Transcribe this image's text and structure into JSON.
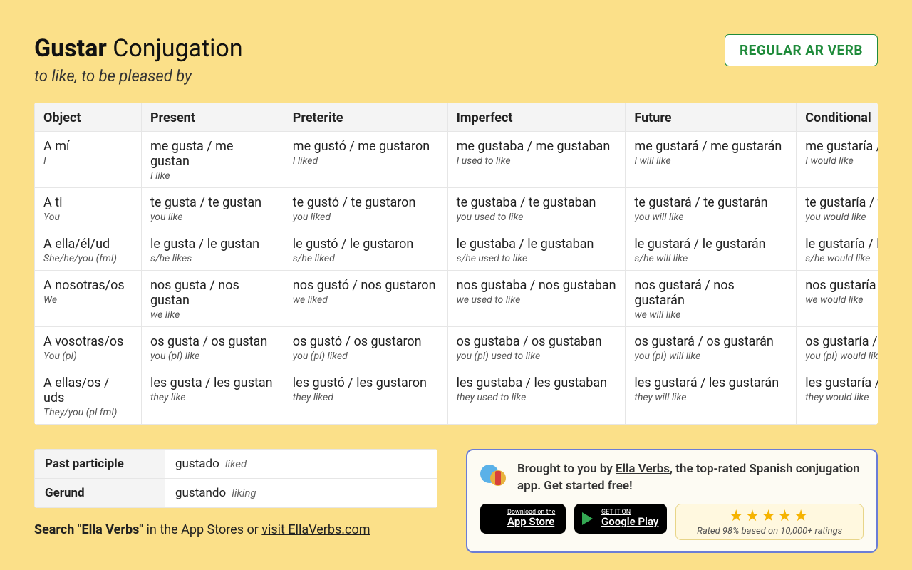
{
  "header": {
    "verb": "Gustar",
    "title_rest": " Conjugation",
    "subtitle": "to like, to be pleased by",
    "badge": "REGULAR AR VERB"
  },
  "columns": [
    "Object",
    "Present",
    "Preterite",
    "Imperfect",
    "Future",
    "Conditional"
  ],
  "rows": [
    {
      "obj_es": "A mí",
      "obj_en": "I",
      "cells": [
        {
          "es": "me gusta / me gustan",
          "en": "I like"
        },
        {
          "es": "me gustó / me gustaron",
          "en": "I liked"
        },
        {
          "es": "me gustaba / me gustaban",
          "en": "I used to like"
        },
        {
          "es": "me gustará / me gustarán",
          "en": "I will like"
        },
        {
          "es": "me gustaría / me gustarían",
          "en": "I would like"
        }
      ]
    },
    {
      "obj_es": "A ti",
      "obj_en": "You",
      "cells": [
        {
          "es": "te gusta / te gustan",
          "en": "you like"
        },
        {
          "es": "te gustó / te gustaron",
          "en": "you liked"
        },
        {
          "es": "te gustaba / te gustaban",
          "en": "you used to like"
        },
        {
          "es": "te gustará / te gustarán",
          "en": "you will like"
        },
        {
          "es": "te gustaría / te gustarían",
          "en": "you would like"
        }
      ]
    },
    {
      "obj_es": "A ella/él/ud",
      "obj_en": "She/he/you (fml)",
      "cells": [
        {
          "es": "le gusta / le gustan",
          "en": "s/he likes"
        },
        {
          "es": "le gustó / le gustaron",
          "en": "s/he liked"
        },
        {
          "es": "le gustaba / le gustaban",
          "en": "s/he used to like"
        },
        {
          "es": "le gustará / le gustarán",
          "en": "s/he will like"
        },
        {
          "es": "le gustaría / le gustarían",
          "en": "s/he would like"
        }
      ]
    },
    {
      "obj_es": "A nosotras/os",
      "obj_en": "We",
      "cells": [
        {
          "es": "nos gusta / nos gustan",
          "en": "we like"
        },
        {
          "es": "nos gustó / nos gustaron",
          "en": "we liked"
        },
        {
          "es": "nos gustaba / nos gustaban",
          "en": "we used to like"
        },
        {
          "es": "nos gustará / nos gustarán",
          "en": "we will like"
        },
        {
          "es": "nos gustaría / nos gustarían",
          "en": "we would like"
        }
      ]
    },
    {
      "obj_es": "A vosotras/os",
      "obj_en": "You (pl)",
      "cells": [
        {
          "es": "os gusta / os gustan",
          "en": "you (pl) like"
        },
        {
          "es": "os gustó / os gustaron",
          "en": "you (pl) liked"
        },
        {
          "es": "os gustaba / os gustaban",
          "en": "you (pl) used to like"
        },
        {
          "es": "os gustará / os gustarán",
          "en": "you (pl) will like"
        },
        {
          "es": "os gustaría / os gustarían",
          "en": "you (pl) would like"
        }
      ]
    },
    {
      "obj_es": "A ellas/os / uds",
      "obj_en": "They/you (pl fml)",
      "cells": [
        {
          "es": "les gusta / les gustan",
          "en": "they like"
        },
        {
          "es": "les gustó / les gustaron",
          "en": "they liked"
        },
        {
          "es": "les gustaba / les gustaban",
          "en": "they used to like"
        },
        {
          "es": "les gustará / les gustarán",
          "en": "they will like"
        },
        {
          "es": "les gustaría / les gustarían",
          "en": "they would like"
        }
      ]
    }
  ],
  "participles": [
    {
      "label": "Past participle",
      "es": "gustado",
      "en": "liked"
    },
    {
      "label": "Gerund",
      "es": "gustando",
      "en": "liking"
    }
  ],
  "search": {
    "prefix": "Search ",
    "quoted": "\"Ella Verbs\"",
    "mid": " in the App Stores or ",
    "link": "visit EllaVerbs.com"
  },
  "promo": {
    "text_pre": "Brought to you by ",
    "link": "Ella Verbs",
    "text_post": ", the top-rated Spanish conjugation app. Get started free!",
    "appstore_small": "Download on the",
    "appstore_big": "App Store",
    "play_small": "GET IT ON",
    "play_big": "Google Play",
    "stars": "★★★★★",
    "rating": "Rated 98% based on 10,000+ ratings"
  }
}
